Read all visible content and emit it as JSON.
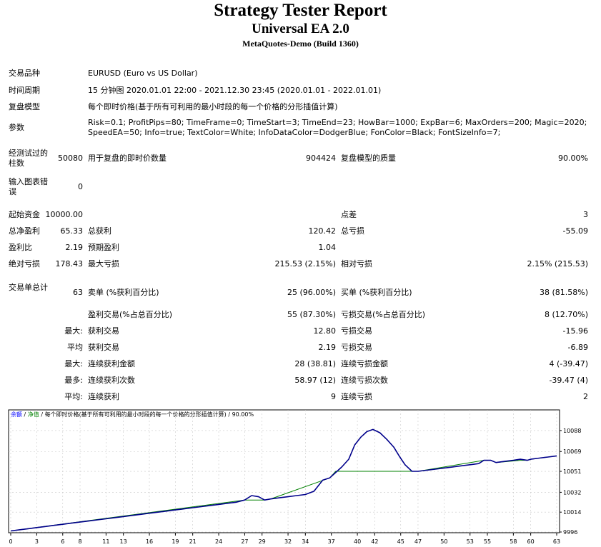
{
  "header": {
    "title": "Strategy Tester Report",
    "ea_name": "Universal EA 2.0",
    "server": "MetaQuotes-Demo (Build 1360)"
  },
  "settings": {
    "symbol_label": "交易品种",
    "symbol": "EURUSD (Euro vs US Dollar)",
    "period_label": "时间周期",
    "period": "15 分钟图 2020.01.01 22:00 - 2021.12.30 23:45 (2020.01.01 - 2022.01.01)",
    "model_label": "复盘模型",
    "model": "每个即时价格(基于所有可利用的最小时段的每一个价格的分形插值计算)",
    "params_label": "参数",
    "params_line1": "Risk=0.1; ProfitPips=80; TimeFrame=0; TimeStart=3; TimeEnd=23; HowBar=1000; ExpBar=6; MaxOrders=200; Magic=2020;",
    "params_line2": "SpeedEA=50; Info=true; TextColor=White; InfoDataColor=DodgerBlue; FonColor=Black; FontSizeInfo=7;"
  },
  "bars": {
    "bars_label": "经测试过的柱数",
    "bars": "50080",
    "ticks_label": "用于复盘的即时价数量",
    "ticks": "904424",
    "quality_label": "复盘模型的质量",
    "quality": "90.00%",
    "errors_label": "输入图表错误",
    "errors": "0"
  },
  "stats": {
    "deposit_label": "起始资金",
    "deposit": "10000.00",
    "spread_label": "点差",
    "spread": "3",
    "net_label": "总净盈利",
    "net": "65.33",
    "gross_profit_label": "总获利",
    "gross_profit": "120.42",
    "gross_loss_label": "总亏损",
    "gross_loss": "-55.09",
    "pf_label": "盈利比",
    "pf": "2.19",
    "payoff_label": "预期盈利",
    "payoff": "1.04",
    "abs_dd_label": "绝对亏损",
    "abs_dd": "178.43",
    "max_dd_label": "最大亏损",
    "max_dd": "215.53 (2.15%)",
    "rel_dd_label": "相对亏损",
    "rel_dd": "2.15% (215.53)",
    "trades_label": "交易单总计",
    "trades": "63",
    "short_label": "卖单 (%获利百分比)",
    "short": "25 (96.00%)",
    "long_label": "买单 (%获利百分比)",
    "long": "38 (81.58%)",
    "profit_trades_label": "盈利交易(%占总百分比)",
    "profit_trades": "55 (87.30%)",
    "loss_trades_label": "亏损交易(%占总百分比)",
    "loss_trades": "8 (12.70%)",
    "largest_label": "最大:",
    "win_label": "获利交易",
    "largest_win": "12.80",
    "loss_label": "亏损交易",
    "largest_loss": "-15.96",
    "average_label": "平均",
    "avg_win": "2.19",
    "avg_loss": "-6.89",
    "max_label": "最大:",
    "cons_wins_amt_label": "连续获利金额",
    "cons_wins_amt": "28 (38.81)",
    "cons_loss_amt_label": "连续亏损金额",
    "cons_loss_amt": "4 (-39.47)",
    "most_label": "最多:",
    "cons_wins_cnt_label": "连续获利次数",
    "cons_wins_cnt": "58.97 (12)",
    "cons_loss_cnt_label": "连续亏损次数",
    "cons_loss_cnt": "-39.47 (4)",
    "avg2_label": "平均:",
    "avg_cons_win_label": "连续获利",
    "avg_cons_win": "9",
    "avg_cons_loss_label": "连续亏损",
    "avg_cons_loss": "2"
  },
  "chart_legend": {
    "balance": "余额",
    "sep1": " / ",
    "equity": "净值",
    "rest": " / 每个即时价格(基于所有可利用的最小时段的每一个价格的分形插值计算) / 90.00%"
  },
  "colors": {
    "balance": "#00008b",
    "equity": "#008000",
    "legend_balance": "#0000ff",
    "legend_equity": "#008000"
  },
  "chart_data": {
    "type": "line",
    "x_ticks": [
      0,
      3,
      6,
      8,
      11,
      13,
      16,
      19,
      21,
      24,
      27,
      29,
      32,
      34,
      37,
      40,
      42,
      45,
      47,
      50,
      53,
      55,
      58,
      60,
      63
    ],
    "y_ticks": [
      9996,
      10014,
      10032,
      10051,
      10069,
      10088
    ],
    "ylim": [
      9996,
      10097
    ],
    "xlim": [
      0,
      63
    ],
    "series": [
      {
        "x": [
          0,
          1,
          2,
          3,
          4,
          5,
          6,
          7,
          8,
          9,
          10,
          11,
          12,
          13,
          14,
          15,
          16,
          17,
          18,
          19,
          20,
          21,
          22,
          23,
          24,
          25,
          26,
          27,
          27.8,
          28.6,
          29.3,
          30,
          31,
          32,
          33,
          34,
          35,
          36,
          36.8,
          37.5,
          38.2,
          39,
          39.7,
          40.4,
          41.1,
          41.8,
          42.6,
          43.4,
          44.2,
          44.9,
          45.5,
          46.3,
          47,
          48,
          49,
          50,
          51,
          52,
          53,
          54,
          54.6,
          55.4,
          56,
          57,
          58,
          58.8,
          59.6,
          60,
          61,
          62,
          63
        ],
        "y": [
          9997,
          9998,
          9999,
          10000,
          10001,
          10002,
          10003,
          10004,
          10005,
          10006,
          10007,
          10008,
          10009,
          10010,
          10011,
          10012,
          10013,
          10014,
          10015,
          10016,
          10017,
          10018,
          10019,
          10020,
          10021,
          10022,
          10023,
          10025,
          10029,
          10028,
          10025,
          10026,
          10027,
          10028,
          10029,
          10030,
          10033,
          10043,
          10045,
          10050,
          10055,
          10062,
          10075,
          10082,
          10087,
          10089,
          10086,
          10080,
          10073,
          10064,
          10057,
          10051,
          10051,
          10052,
          10053,
          10054,
          10055,
          10056,
          10057,
          10058,
          10061,
          10061,
          10059,
          10060,
          10061,
          10062,
          10061,
          10062,
          10063,
          10064,
          10065
        ]
      },
      {
        "x": [
          0,
          27,
          27.8,
          29.3,
          30,
          36.8,
          37.5,
          46.3,
          47,
          54.6,
          55.4,
          56,
          58.8,
          59.6,
          60,
          63
        ],
        "y": [
          9997,
          10025,
          10025,
          10025,
          10026,
          10045,
          10051,
          10051,
          10051,
          10061,
          10061,
          10059,
          10061,
          10061,
          10062,
          10065
        ]
      }
    ]
  }
}
